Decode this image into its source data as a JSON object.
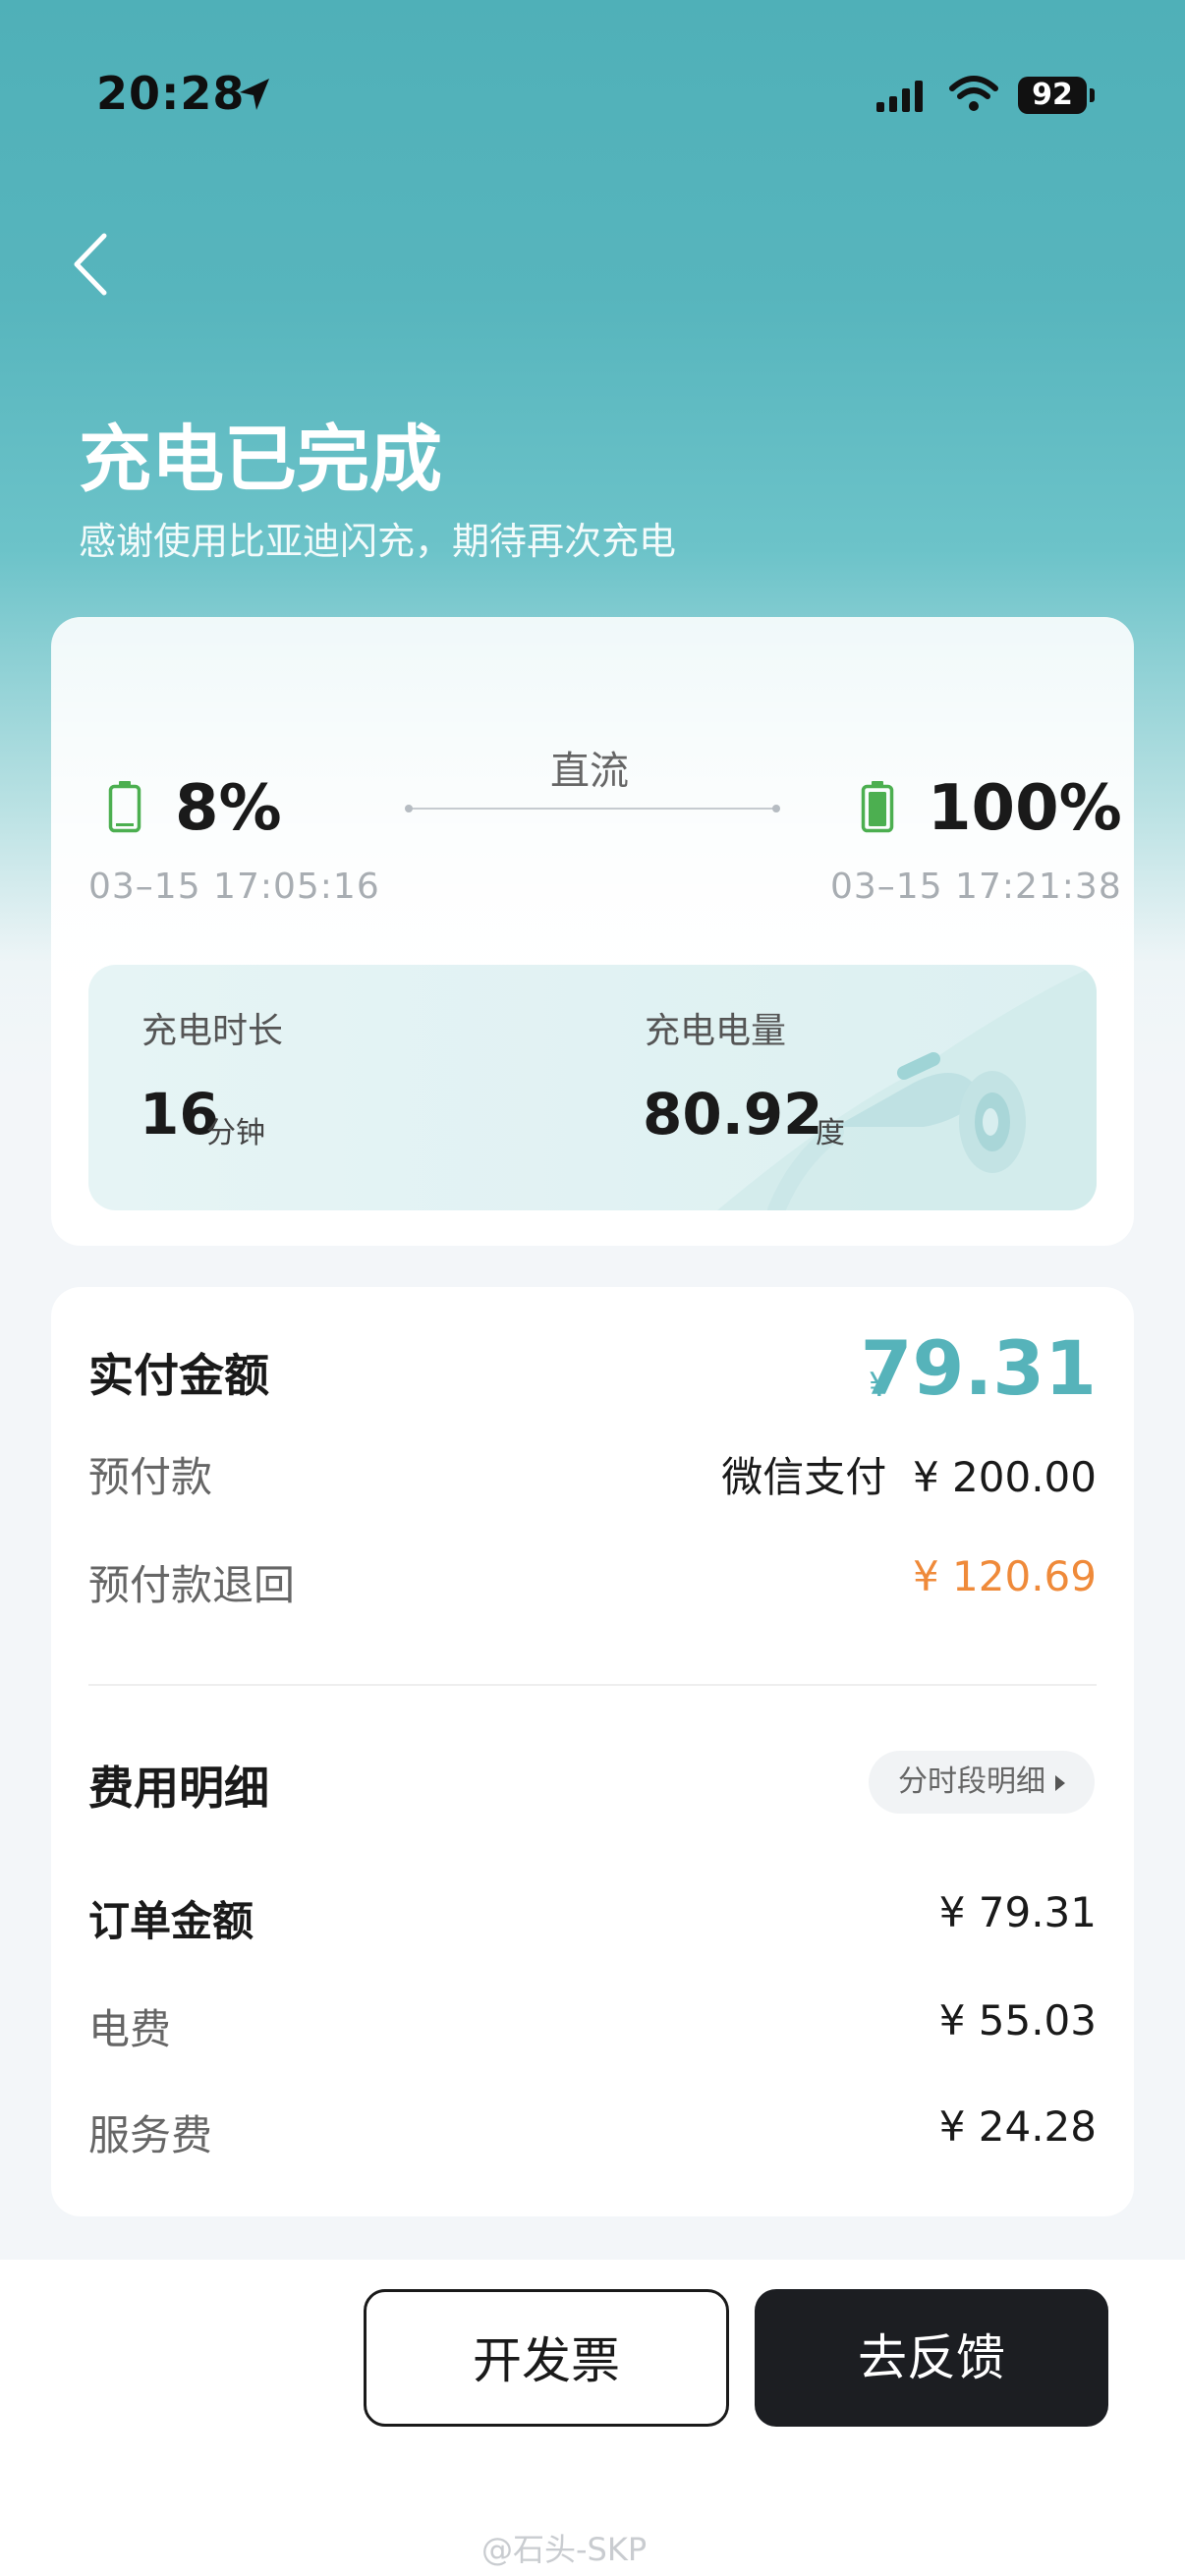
{
  "status_bar": {
    "time": "20:28",
    "battery": "92"
  },
  "header": {
    "title": "充电已完成",
    "subtitle": "感谢使用比亚迪闪充，期待再次充电"
  },
  "session": {
    "mode": "直流",
    "start": {
      "percent": "8%",
      "time": "03–15 17:05:16"
    },
    "end": {
      "percent": "100%",
      "time": "03–15 17:21:38"
    },
    "duration": {
      "label": "充电时长",
      "value": "16",
      "unit": "分钟"
    },
    "energy": {
      "label": "充电电量",
      "value": "80.92",
      "unit": "度"
    }
  },
  "payment": {
    "paid_label": "实付金额",
    "paid_symbol": "¥",
    "paid_amount": "79.31",
    "prepay_label": "预付款",
    "prepay_value": "微信支付  ¥ 200.00",
    "refund_label": "预付款退回",
    "refund_value": "¥ 120.69"
  },
  "fees": {
    "title": "费用明细",
    "detail_button": "分时段明细",
    "rows": [
      {
        "label": "订单金额",
        "value": "¥ 79.31"
      },
      {
        "label": "电费",
        "value": "¥ 55.03"
      },
      {
        "label": "服务费",
        "value": "¥ 24.28"
      }
    ]
  },
  "actions": {
    "invoice": "开发票",
    "feedback": "去反馈"
  },
  "watermark": "@石头-SKP",
  "colors": {
    "accent": "#56b3ba",
    "refund": "#ef8a3a",
    "battery_green": "#4caf50",
    "dark_button": "#1c1e22"
  }
}
